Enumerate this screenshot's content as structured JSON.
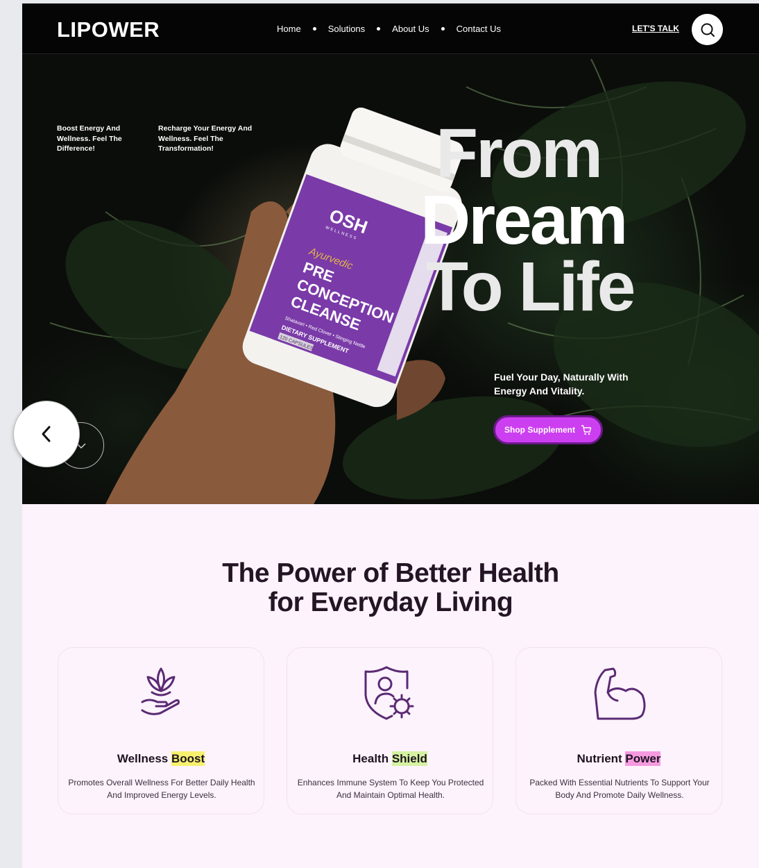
{
  "brand": {
    "logo": "LIPOWER"
  },
  "nav": {
    "items": [
      "Home",
      "Solutions",
      "About Us",
      "Contact Us"
    ],
    "cta": "LET'S TALK"
  },
  "hero": {
    "blurbs": [
      "Boost Energy And Wellness. Feel The Difference!",
      "Recharge Your Energy And Wellness. Feel The Transformation!"
    ],
    "headline": [
      "From",
      "Dream",
      "To Life"
    ],
    "tagline": "Fuel Your Day, Naturally With Energy And Vitality.",
    "shop_button": "Shop Supplement",
    "product": {
      "brand": "OSH",
      "brand_sub": "WELLNESS",
      "line1": "Ayurvedic",
      "line2": "PRE",
      "line3": "CONCEPTION",
      "line4": "CLEANSE",
      "ingredients": "Shatavari • Red Clover • Stinging Nettle",
      "type": "DIETARY SUPPLEMENT",
      "count": "120 CAPSULES"
    }
  },
  "features": {
    "title_line1": "The Power of Better Health",
    "title_line2": "for Everyday Living",
    "cards": [
      {
        "title_plain": "Wellness ",
        "title_hl": "Boost",
        "highlight": "#f7f06e",
        "icon": "lotus-hand-icon",
        "desc": "Promotes Overall Wellness For Better Daily Health And Improved Energy Levels."
      },
      {
        "title_plain": "Health ",
        "title_hl": "Shield",
        "highlight": "#d5f2a2",
        "icon": "shield-virus-icon",
        "desc": "Enhances Immune System To Keep You Protected And Maintain Optimal Health."
      },
      {
        "title_plain": "Nutrient ",
        "title_hl": "Power",
        "highlight": "#f59adf",
        "icon": "flexed-arm-icon",
        "desc": "Packed With Essential Nutrients To Support Your Body And Promote Daily Wellness."
      }
    ]
  },
  "colors": {
    "accent": "#cc3ff0",
    "icon": "#5b2a73",
    "page_bg": "#fcf3fd"
  }
}
